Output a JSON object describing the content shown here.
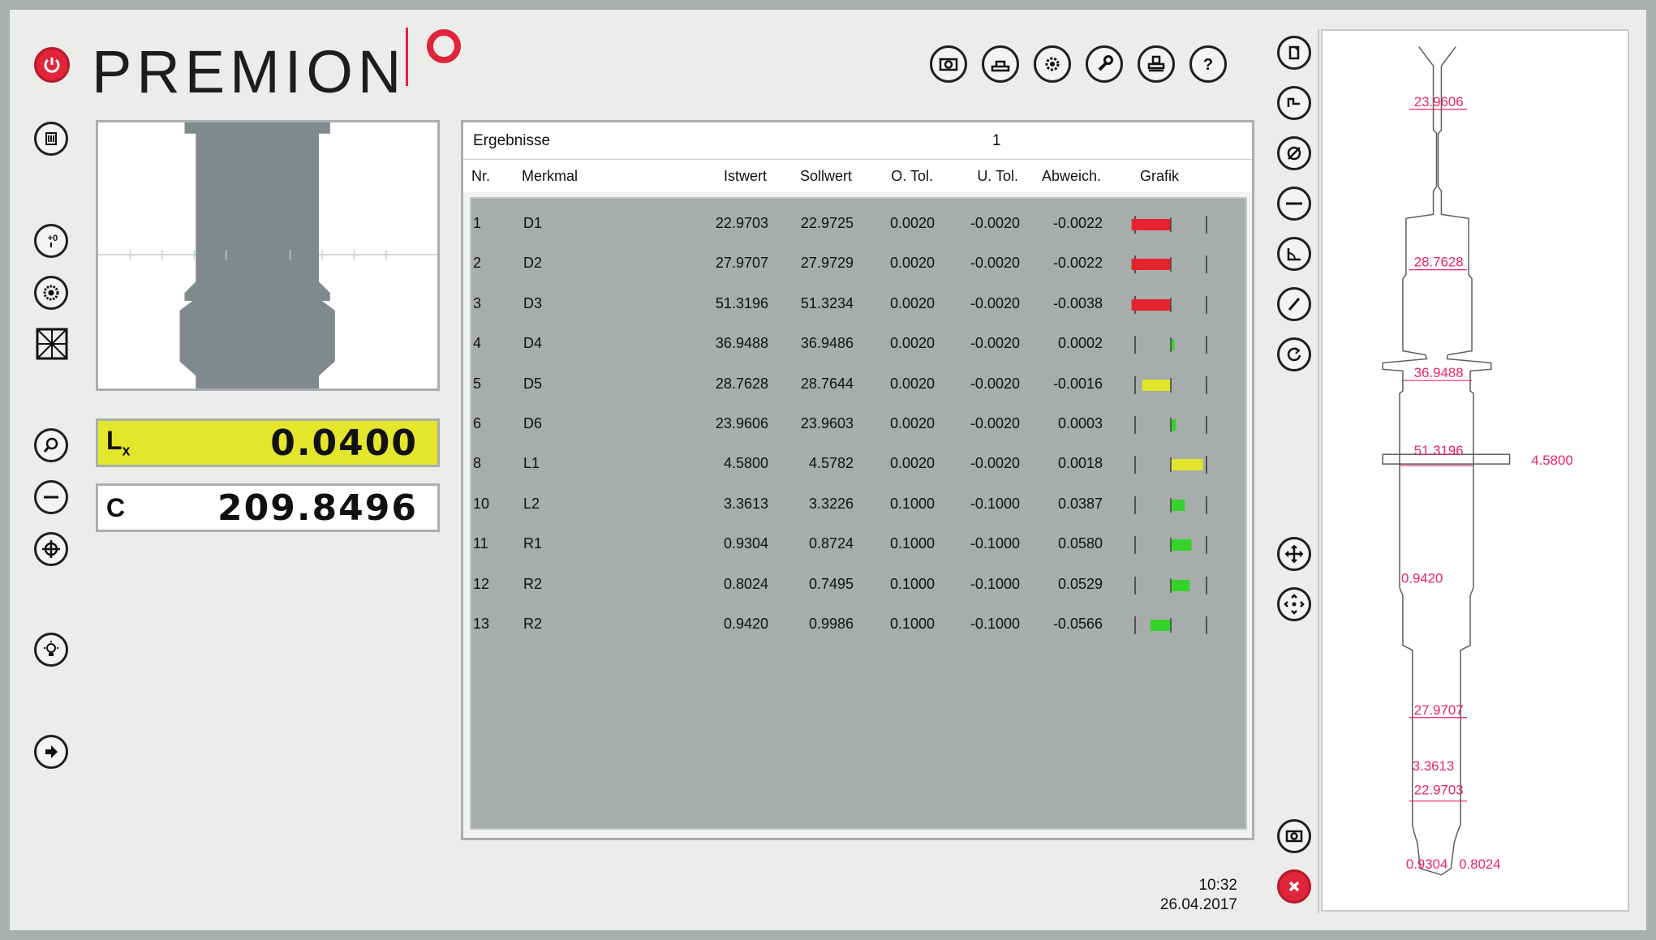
{
  "app": {
    "logo_text": "PREMION",
    "accent_color": "#e0243a"
  },
  "toolbar_top": {
    "icons": [
      "camera-icon",
      "measure-table-icon",
      "settings-gear-icon",
      "wrench-icon",
      "stamp-icon",
      "help-icon"
    ]
  },
  "left_sidebar": {
    "icons": [
      "power-icon",
      "list-icon",
      "zero-set-icon",
      "lens-icon",
      "grid-icon",
      "zoom-icon",
      "minus-icon",
      "target-icon",
      "light-icon",
      "next-arrow-icon"
    ]
  },
  "readouts": {
    "lx": {
      "label_main": "L",
      "label_sub": "x",
      "value": "0.0400"
    },
    "c": {
      "label": "C",
      "value": "209.8496"
    }
  },
  "results": {
    "title": "Ergebnisse",
    "number": "1",
    "columns": {
      "nr": "Nr.",
      "merkmal": "Merkmal",
      "istwert": "Istwert",
      "sollwert": "Sollwert",
      "otol": "O. Tol.",
      "utol": "U. Tol.",
      "abweich": "Abweich.",
      "grafik": "Grafik"
    },
    "rows": [
      {
        "nr": "1",
        "merkmal": "D1",
        "istwert": "22.9703",
        "sollwert": "22.9725",
        "otol": "0.0020",
        "utol": "-0.0020",
        "abweich": "-0.0022",
        "dev_fraction": -1.1,
        "color": "#e5232e"
      },
      {
        "nr": "2",
        "merkmal": "D2",
        "istwert": "27.9707",
        "sollwert": "27.9729",
        "otol": "0.0020",
        "utol": "-0.0020",
        "abweich": "-0.0022",
        "dev_fraction": -1.1,
        "color": "#e5232e"
      },
      {
        "nr": "3",
        "merkmal": "D3",
        "istwert": "51.3196",
        "sollwert": "51.3234",
        "otol": "0.0020",
        "utol": "-0.0020",
        "abweich": "-0.0038",
        "dev_fraction": -1.1,
        "color": "#e5232e"
      },
      {
        "nr": "4",
        "merkmal": "D4",
        "istwert": "36.9488",
        "sollwert": "36.9486",
        "otol": "0.0020",
        "utol": "-0.0020",
        "abweich": "0.0002",
        "dev_fraction": 0.1,
        "color": "#35d32a"
      },
      {
        "nr": "5",
        "merkmal": "D5",
        "istwert": "28.7628",
        "sollwert": "28.7644",
        "otol": "0.0020",
        "utol": "-0.0020",
        "abweich": "-0.0016",
        "dev_fraction": -0.8,
        "color": "#e3e52b"
      },
      {
        "nr": "6",
        "merkmal": "D6",
        "istwert": "23.9606",
        "sollwert": "23.9603",
        "otol": "0.0020",
        "utol": "-0.0020",
        "abweich": "0.0003",
        "dev_fraction": 0.15,
        "color": "#35d32a"
      },
      {
        "nr": "8",
        "merkmal": "L1",
        "istwert": "4.5800",
        "sollwert": "4.5782",
        "otol": "0.0020",
        "utol": "-0.0020",
        "abweich": "0.0018",
        "dev_fraction": 0.9,
        "color": "#e3e52b"
      },
      {
        "nr": "10",
        "merkmal": "L2",
        "istwert": "3.3613",
        "sollwert": "3.3226",
        "otol": "0.1000",
        "utol": "-0.1000",
        "abweich": "0.0387",
        "dev_fraction": 0.39,
        "color": "#35d32a"
      },
      {
        "nr": "11",
        "merkmal": "R1",
        "istwert": "0.9304",
        "sollwert": "0.8724",
        "otol": "0.1000",
        "utol": "-0.1000",
        "abweich": "0.0580",
        "dev_fraction": 0.58,
        "color": "#35d32a"
      },
      {
        "nr": "12",
        "merkmal": "R2",
        "istwert": "0.8024",
        "sollwert": "0.7495",
        "otol": "0.1000",
        "utol": "-0.1000",
        "abweich": "0.0529",
        "dev_fraction": 0.53,
        "color": "#35d32a"
      },
      {
        "nr": "13",
        "merkmal": "R2",
        "istwert": "0.9420",
        "sollwert": "0.9986",
        "otol": "0.1000",
        "utol": "-0.1000",
        "abweich": "-0.0566",
        "dev_fraction": -0.57,
        "color": "#35d32a"
      }
    ]
  },
  "status": {
    "time": "10:32",
    "date": "26.04.2017"
  },
  "right_toolbar": {
    "icons": [
      "new-document-icon",
      "trace-icon",
      "diameter-icon",
      "line-icon",
      "angle-icon",
      "radius-icon",
      "rotate-icon",
      "move-icon",
      "center-icon",
      "camera-icon",
      "close-icon"
    ]
  },
  "profile_labels": {
    "d6": "23.9606",
    "d5": "28.7628",
    "d4": "36.9488",
    "d3": "51.3196",
    "l1": "4.5800",
    "r13": "0.9420",
    "d2": "27.9707",
    "l2": "3.3613",
    "d1": "22.9703",
    "r11": "0.9304",
    "r12": "0.8024"
  }
}
